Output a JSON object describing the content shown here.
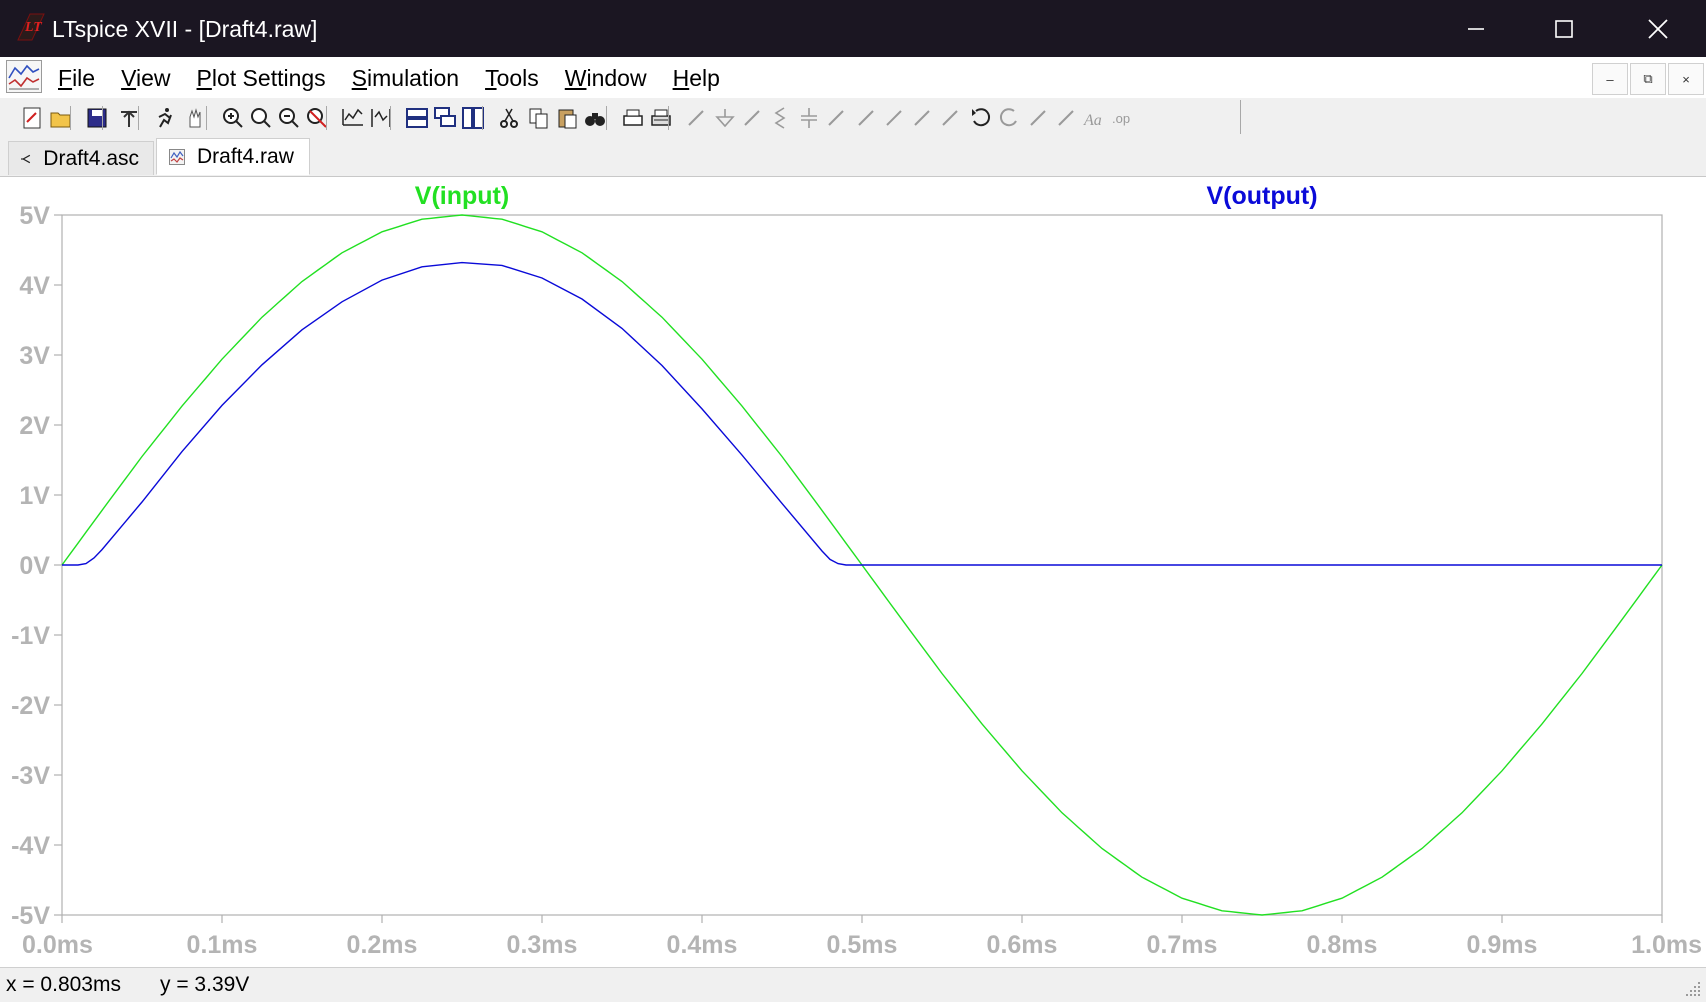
{
  "window": {
    "title": "LTspice XVII - [Draft4.raw]",
    "logo_icon": "ltspice-logo-icon",
    "controls": [
      "minimize",
      "maximize",
      "close"
    ]
  },
  "menu": {
    "items": [
      {
        "label_acc": "F",
        "label_rest": "ile"
      },
      {
        "label_acc": "V",
        "label_rest": "iew"
      },
      {
        "label_acc": "P",
        "label_rest": "lot Settings"
      },
      {
        "label_acc": "S",
        "label_rest": "imulation"
      },
      {
        "label_acc": "T",
        "label_rest": "ools"
      },
      {
        "label_acc": "W",
        "label_rest": "indow"
      },
      {
        "label_acc": "H",
        "label_rest": "elp"
      }
    ],
    "mdi_controls": [
      "–",
      "⧉",
      "×"
    ]
  },
  "toolbar": {
    "icons": [
      "new-schematic-icon",
      "open-icon",
      "save-icon",
      "control-panel-icon",
      "run-icon",
      "halt-icon",
      "zoom-in-icon",
      "zoom-area-icon",
      "zoom-out-icon",
      "zoom-full-icon",
      "autorange-icon",
      "cursor-icon",
      "tile-horizontal-icon",
      "cascade-icon",
      "tile-vertical-icon",
      "cut-icon",
      "copy-icon",
      "paste-icon",
      "find-icon",
      "print-icon",
      "print-setup-icon",
      "wire-icon",
      "ground-icon",
      "label-icon",
      "resistor-icon",
      "capacitor-icon",
      "inductor-icon",
      "diode-icon",
      "component-icon",
      "move-icon",
      "drag-icon",
      "undo-icon",
      "redo-icon",
      "rotate-icon",
      "mirror-icon",
      "text-icon",
      "spice-directive-icon"
    ]
  },
  "tabs": [
    {
      "label": "Draft4.asc",
      "icon": "schematic-tab-icon",
      "active": false
    },
    {
      "label": "Draft4.raw",
      "icon": "waveform-tab-icon",
      "active": true
    }
  ],
  "colors": {
    "input": "#22e022",
    "output": "#0a0ad8",
    "axis_text": "#b4b4b4",
    "axis_line": "#b0b0b0"
  },
  "chart_data": {
    "type": "line",
    "x_ticks": [
      "0.0ms",
      "0.1ms",
      "0.2ms",
      "0.3ms",
      "0.4ms",
      "0.5ms",
      "0.6ms",
      "0.7ms",
      "0.8ms",
      "0.9ms",
      "1.0ms"
    ],
    "y_ticks": [
      "5V",
      "4V",
      "3V",
      "2V",
      "1V",
      "0V",
      "-1V",
      "-2V",
      "-3V",
      "-4V",
      "-5V"
    ],
    "xlim": [
      0,
      1.0
    ],
    "ylim": [
      -5,
      5
    ],
    "series": [
      {
        "name": "V(input)",
        "color": "#22e022",
        "x": [
          0,
          0.025,
          0.05,
          0.075,
          0.1,
          0.125,
          0.15,
          0.175,
          0.2,
          0.225,
          0.25,
          0.275,
          0.3,
          0.325,
          0.35,
          0.375,
          0.4,
          0.425,
          0.45,
          0.475,
          0.5,
          0.525,
          0.55,
          0.575,
          0.6,
          0.625,
          0.65,
          0.675,
          0.7,
          0.725,
          0.75,
          0.775,
          0.8,
          0.825,
          0.85,
          0.875,
          0.9,
          0.925,
          0.95,
          0.975,
          1.0
        ],
        "y": [
          0,
          0.78,
          1.55,
          2.27,
          2.94,
          3.54,
          4.05,
          4.46,
          4.76,
          4.94,
          5.0,
          4.94,
          4.76,
          4.46,
          4.05,
          3.54,
          2.94,
          2.27,
          1.55,
          0.78,
          0,
          -0.78,
          -1.55,
          -2.27,
          -2.94,
          -3.54,
          -4.05,
          -4.46,
          -4.76,
          -4.94,
          -5.0,
          -4.94,
          -4.76,
          -4.46,
          -4.05,
          -3.54,
          -2.94,
          -2.27,
          -1.55,
          -0.78,
          0
        ]
      },
      {
        "name": "V(output)",
        "color": "#0a0ad8",
        "x": [
          0,
          0.01,
          0.015,
          0.02,
          0.025,
          0.05,
          0.075,
          0.1,
          0.125,
          0.15,
          0.175,
          0.2,
          0.225,
          0.25,
          0.275,
          0.3,
          0.325,
          0.35,
          0.375,
          0.4,
          0.425,
          0.45,
          0.475,
          0.48,
          0.485,
          0.49,
          0.5,
          0.6,
          0.7,
          0.8,
          0.9,
          1.0
        ],
        "y": [
          0,
          0,
          0.02,
          0.1,
          0.22,
          0.9,
          1.62,
          2.28,
          2.86,
          3.36,
          3.76,
          4.07,
          4.26,
          4.32,
          4.28,
          4.1,
          3.8,
          3.38,
          2.85,
          2.23,
          1.57,
          0.88,
          0.2,
          0.08,
          0.02,
          0,
          0,
          0,
          0,
          0,
          0,
          0
        ]
      }
    ]
  },
  "status": {
    "x_readout": "x = 0.803ms",
    "y_readout": "y = 3.39V"
  }
}
